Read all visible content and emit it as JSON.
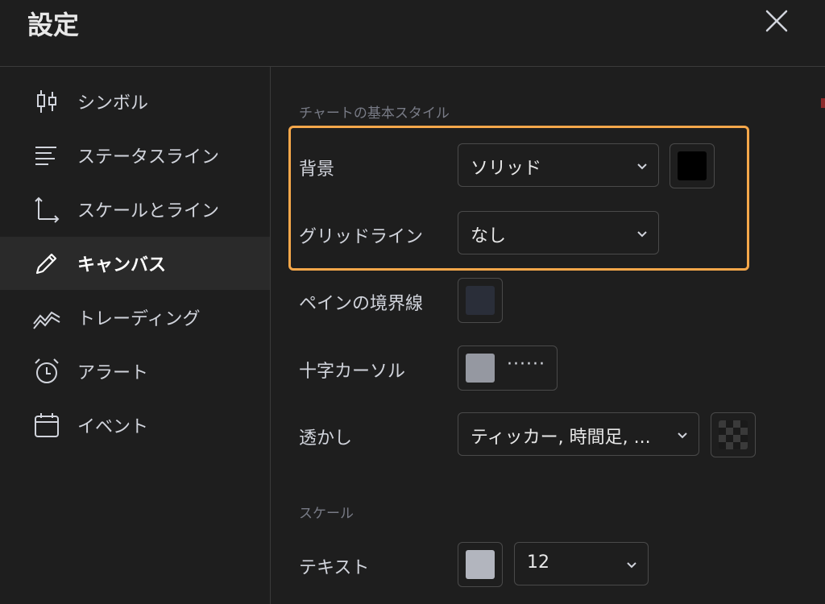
{
  "header": {
    "title": "設定"
  },
  "sidebar": {
    "items": [
      {
        "label": "シンボル",
        "icon": "candlestick-icon"
      },
      {
        "label": "ステータスライン",
        "icon": "status-line-icon"
      },
      {
        "label": "スケールとライン",
        "icon": "scales-icon"
      },
      {
        "label": "キャンバス",
        "icon": "pencil-icon",
        "active": true
      },
      {
        "label": "トレーディング",
        "icon": "trading-icon"
      },
      {
        "label": "アラート",
        "icon": "alarm-clock-icon"
      },
      {
        "label": "イベント",
        "icon": "calendar-icon"
      }
    ]
  },
  "canvas": {
    "section_basic": "チャートの基本スタイル",
    "background": {
      "label": "背景",
      "value": "ソリッド",
      "color": "#000000"
    },
    "grid": {
      "label": "グリッドライン",
      "value": "なし"
    },
    "pane_border": {
      "label": "ペインの境界線",
      "color": "#2a2e39"
    },
    "crosshair": {
      "label": "十字カーソル",
      "color": "#9598a1",
      "line_style": "······"
    },
    "watermark": {
      "label": "透かし",
      "value": "ティッカー, 時間足, ..."
    },
    "section_scale": "スケール",
    "text": {
      "label": "テキスト",
      "color": "#b2b5be",
      "size": "12"
    }
  },
  "colors": {
    "highlight": "#f5a74a",
    "background": "#1e1e1e"
  }
}
